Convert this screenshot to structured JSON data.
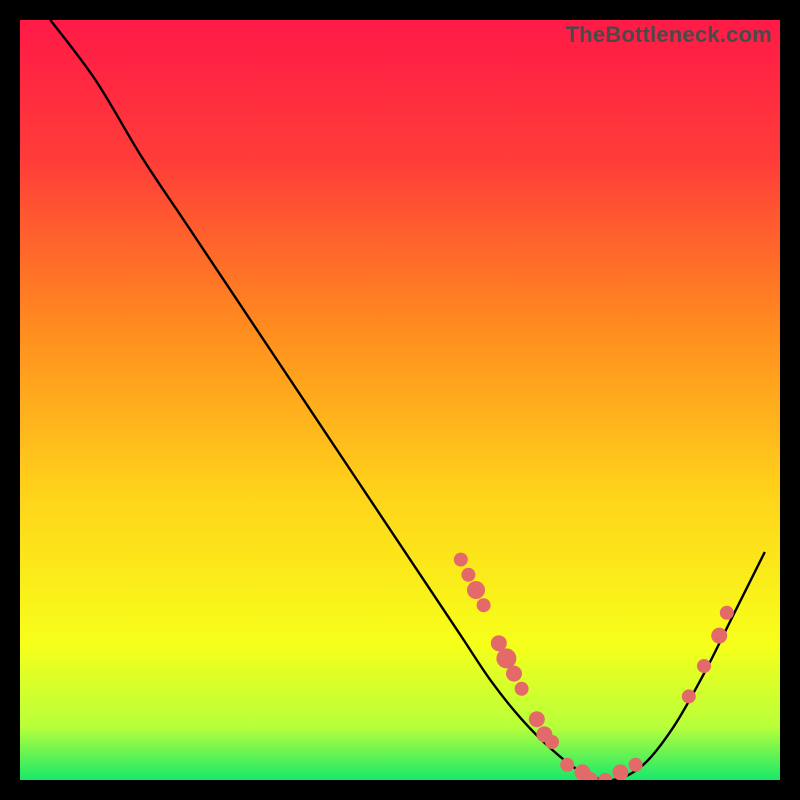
{
  "watermark": "TheBottleneck.com",
  "chart_data": {
    "type": "line",
    "title": "",
    "xlabel": "",
    "ylabel": "",
    "xlim": [
      0,
      100
    ],
    "ylim": [
      0,
      100
    ],
    "grid": false,
    "legend": false,
    "gradient_stops": [
      {
        "offset": 0.0,
        "color": "#ff1a47"
      },
      {
        "offset": 0.18,
        "color": "#ff3b39"
      },
      {
        "offset": 0.4,
        "color": "#ff8a1f"
      },
      {
        "offset": 0.62,
        "color": "#ffd21a"
      },
      {
        "offset": 0.82,
        "color": "#f7ff1a"
      },
      {
        "offset": 0.93,
        "color": "#b8ff3a"
      },
      {
        "offset": 1.0,
        "color": "#17e86b"
      }
    ],
    "series": [
      {
        "name": "bottleneck-curve",
        "x": [
          4,
          10,
          16,
          22,
          28,
          34,
          40,
          46,
          52,
          58,
          62,
          66,
          70,
          74,
          78,
          82,
          86,
          90,
          94,
          98
        ],
        "y": [
          100,
          92,
          82,
          73,
          64,
          55,
          46,
          37,
          28,
          19,
          13,
          8,
          4,
          1,
          0,
          2,
          7,
          14,
          22,
          30
        ]
      }
    ],
    "markers": {
      "name": "sample-points",
      "color": "#e46a6a",
      "points": [
        {
          "x": 58,
          "y": 29,
          "r": 7
        },
        {
          "x": 59,
          "y": 27,
          "r": 7
        },
        {
          "x": 60,
          "y": 25,
          "r": 9
        },
        {
          "x": 61,
          "y": 23,
          "r": 7
        },
        {
          "x": 63,
          "y": 18,
          "r": 8
        },
        {
          "x": 64,
          "y": 16,
          "r": 10
        },
        {
          "x": 65,
          "y": 14,
          "r": 8
        },
        {
          "x": 66,
          "y": 12,
          "r": 7
        },
        {
          "x": 68,
          "y": 8,
          "r": 8
        },
        {
          "x": 69,
          "y": 6,
          "r": 8
        },
        {
          "x": 70,
          "y": 5,
          "r": 7
        },
        {
          "x": 72,
          "y": 2,
          "r": 7
        },
        {
          "x": 74,
          "y": 1,
          "r": 8
        },
        {
          "x": 75,
          "y": 0,
          "r": 8
        },
        {
          "x": 77,
          "y": 0,
          "r": 7
        },
        {
          "x": 79,
          "y": 1,
          "r": 8
        },
        {
          "x": 81,
          "y": 2,
          "r": 7
        },
        {
          "x": 88,
          "y": 11,
          "r": 7
        },
        {
          "x": 90,
          "y": 15,
          "r": 7
        },
        {
          "x": 92,
          "y": 19,
          "r": 8
        },
        {
          "x": 93,
          "y": 22,
          "r": 7
        }
      ]
    }
  }
}
